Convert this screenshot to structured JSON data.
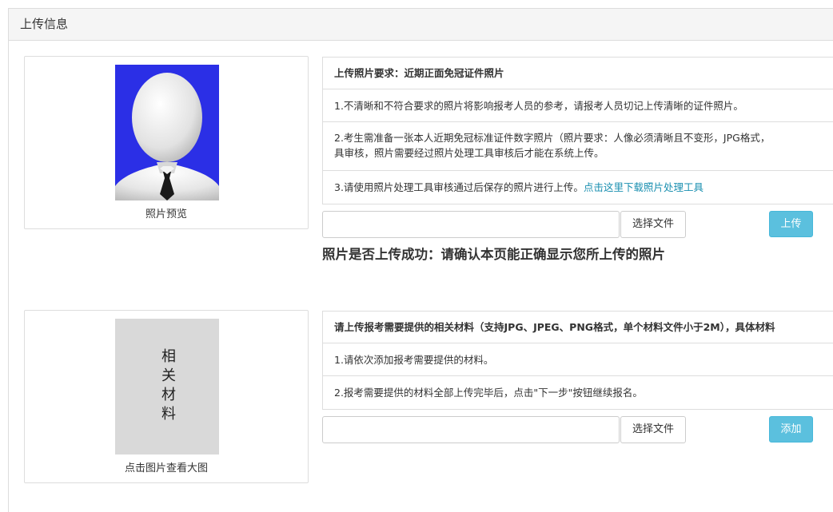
{
  "panel": {
    "title": "上传信息"
  },
  "photo": {
    "caption": "照片预览",
    "requirements": {
      "header": "上传照片要求：近期正面免冠证件照片",
      "item1": "1.不清晰和不符合要求的照片将影响报考人员的参考，请报考人员切记上传清晰的证件照片。",
      "item2_line1": "2.考生需准备一张本人近期免冠标准证件数字照片（照片要求：人像必须清晰且不变形，JPG格式，",
      "item2_line2": "具审核，照片需要经过照片处理工具审核后才能在系统上传。",
      "item3": "3.请使用照片处理工具审核通过后保存的照片进行上传。",
      "item3_link": "点击这里下载照片处理工具"
    },
    "choose_label": "选择文件",
    "upload_label": "上传",
    "notice": "照片是否上传成功：请确认本页能正确显示您所上传的照片"
  },
  "material": {
    "thumb_text": "相关材料",
    "caption": "点击图片查看大图",
    "requirements": {
      "header": "请上传报考需要提供的相关材料（支持JPG、JPEG、PNG格式，单个材料文件小于2M），具体材料",
      "item1": "1.请依次添加报考需要提供的材料。",
      "item2": "2.报考需要提供的材料全部上传完毕后，点击\"下一步\"按钮继续报名。"
    },
    "choose_label": "选择文件",
    "add_label": "添加"
  },
  "colors": {
    "photo_background": "#2b2fe6",
    "info_button": "#5bc0de",
    "link": "#1a8fb0"
  }
}
